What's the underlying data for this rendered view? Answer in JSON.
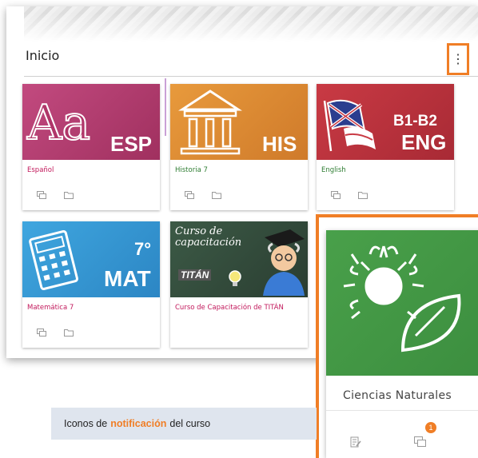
{
  "header": {
    "title": "Inicio",
    "menu_icon": "⋮"
  },
  "courses": [
    {
      "id": "esp",
      "image_text": "Aa",
      "image_code": "ESP",
      "label": "Español",
      "label_color": "#c2185b"
    },
    {
      "id": "his",
      "image_text": "",
      "image_code": "HIS",
      "label": "Historia 7",
      "label_color": "#2e7d32"
    },
    {
      "id": "eng",
      "image_text": "B1-B2",
      "image_code": "ENG",
      "label": "English",
      "label_color": "#2e7d32"
    },
    {
      "id": "mat",
      "image_text": "7°",
      "image_code": "MAT",
      "label": "Matemática 7",
      "label_color": "#c2185b"
    },
    {
      "id": "titan",
      "image_text": "Curso de capacitación",
      "image_code": "TITÁN",
      "label": "Curso de Capacitación de TITÁN",
      "label_color": "#c2185b"
    }
  ],
  "featured": {
    "name": "Ciencias Naturales",
    "notification_count": "1"
  },
  "caption": {
    "prefix": "Iconos de",
    "highlight": "notificación",
    "suffix": "del curso"
  },
  "colors": {
    "accent": "#f07e26"
  }
}
